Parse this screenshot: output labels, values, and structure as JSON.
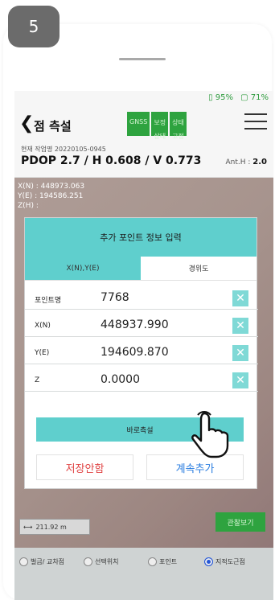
{
  "step": "5",
  "status": {
    "battery1": "95%",
    "battery2": "71%"
  },
  "header": {
    "title": "점 측설",
    "gnss": [
      {
        "label": "GNSS",
        "value": ""
      },
      {
        "label": "보정",
        "value": "상태"
      },
      {
        "label": "상태",
        "value": "고정"
      }
    ]
  },
  "work": {
    "project": "현재 작업명 20220105-0945",
    "pdop": "PDOP 2.7 / H 0.608 / V 0.773",
    "anth_label": "Ant.H :",
    "anth_value": "2.0"
  },
  "map": {
    "x_coord": "X(N) : 448973.063",
    "y_coord": "Y(E) : 194586.251",
    "z_coord": "Z(H) :",
    "scale": "211.92 m",
    "view_result": "관찰보기",
    "options": [
      "벌금/ 교차점",
      "선택위치",
      "포인트",
      "지적도근점"
    ]
  },
  "dialog": {
    "title": "추가 포인트 정보 입력",
    "tabs": [
      "X(N),Y(E)",
      "경위도"
    ],
    "fields": [
      {
        "label": "포인트명",
        "value": "7768"
      },
      {
        "label": "X(N)",
        "value": "448937.990"
      },
      {
        "label": "Y(E)",
        "value": "194609.870"
      },
      {
        "label": "Z",
        "value": "0.0000"
      }
    ],
    "measure_button": "바로측설",
    "save_no": "저장안함",
    "continue_add": "계속추가"
  },
  "colors": {
    "teal": "#5fcfcd",
    "green": "#2ea33f",
    "red": "#e04545",
    "blue": "#2a7de0"
  }
}
